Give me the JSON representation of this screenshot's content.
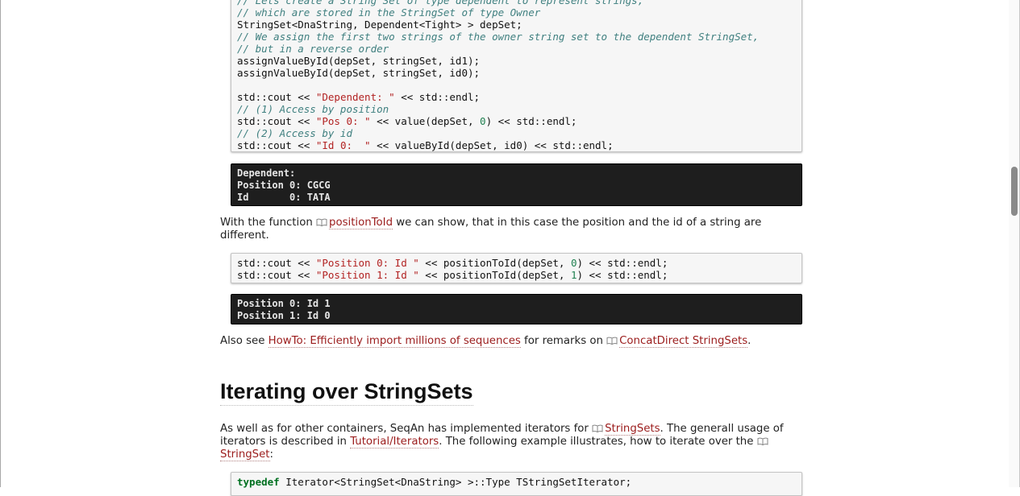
{
  "code_block_1": {
    "lines": [
      [
        {
          "c": "cm",
          "t": "// Lets create a String Set of type dependent to represent strings,"
        }
      ],
      [
        {
          "c": "cm",
          "t": "// which are stored in the StringSet of type Owner"
        }
      ],
      [
        {
          "c": "",
          "t": "StringSet<DnaString, Dependent<Tight> > depSet;"
        }
      ],
      [
        {
          "c": "cm",
          "t": "// We assign the first two strings of the owner string set to the dependent StringSet,"
        }
      ],
      [
        {
          "c": "cm",
          "t": "// but in a reverse order"
        }
      ],
      [
        {
          "c": "",
          "t": "assignValueById(depSet, stringSet, id1);"
        }
      ],
      [
        {
          "c": "",
          "t": "assignValueById(depSet, stringSet, id0);"
        }
      ],
      [
        {
          "c": "",
          "t": ""
        }
      ],
      [
        {
          "c": "",
          "t": "std::cout << "
        },
        {
          "c": "st",
          "t": "\"Dependent: \""
        },
        {
          "c": "",
          "t": " << std::endl;"
        }
      ],
      [
        {
          "c": "cm",
          "t": "// (1) Access by position"
        }
      ],
      [
        {
          "c": "",
          "t": "std::cout << "
        },
        {
          "c": "st",
          "t": "\"Pos 0: \""
        },
        {
          "c": "",
          "t": " << value(depSet, "
        },
        {
          "c": "num",
          "t": "0"
        },
        {
          "c": "",
          "t": ") << std::endl;"
        }
      ],
      [
        {
          "c": "cm",
          "t": "// (2) Access by id"
        }
      ],
      [
        {
          "c": "",
          "t": "std::cout << "
        },
        {
          "c": "st",
          "t": "\"Id 0:  \""
        },
        {
          "c": "",
          "t": " << valueById(depSet, id0) << std::endl;"
        }
      ]
    ]
  },
  "output_block_1": {
    "lines": [
      "Dependent:",
      "Position 0: CGCG",
      "Id       0: TATA"
    ]
  },
  "para_1": {
    "before": "With the function ",
    "link": "positionToId",
    "after": " we can show, that in this case the position and the id of a string are different."
  },
  "code_block_2": {
    "lines": [
      [
        {
          "c": "",
          "t": "std::cout << "
        },
        {
          "c": "st",
          "t": "\"Position 0: Id \""
        },
        {
          "c": "",
          "t": " << positionToId(depSet, "
        },
        {
          "c": "num",
          "t": "0"
        },
        {
          "c": "",
          "t": ") << std::endl;"
        }
      ],
      [
        {
          "c": "",
          "t": "std::cout << "
        },
        {
          "c": "st",
          "t": "\"Position 1: Id \""
        },
        {
          "c": "",
          "t": " << positionToId(depSet, "
        },
        {
          "c": "num",
          "t": "1"
        },
        {
          "c": "",
          "t": ") << std::endl;"
        }
      ]
    ]
  },
  "output_block_2": {
    "lines": [
      "Position 0: Id 1",
      "Position 1: Id 0"
    ]
  },
  "para_2": {
    "before": "Also see ",
    "link1": "HowTo: Efficiently import millions of sequences",
    "middle": " for remarks on ",
    "link2": "ConcatDirect StringSets",
    "after": "."
  },
  "section": {
    "title": "Iterating over StringSets"
  },
  "para_3": {
    "before": "As well as for other containers, SeqAn has implemented iterators for ",
    "link1": "StringSets",
    "middle1": ". The generall usage of iterators is described in ",
    "link2": "Tutorial/Iterators",
    "middle2": ". The following example illustrates, how to iterate over the ",
    "link3": "StringSet",
    "after": ":"
  },
  "code_block_3": {
    "lines": [
      [
        {
          "c": "kw",
          "t": "typedef"
        },
        {
          "c": "",
          "t": " Iterator<StringSet<DnaString> >::Type TStringSetIterator;"
        }
      ]
    ]
  },
  "colors": {
    "link": "#9b1c1c",
    "comment": "#408080",
    "string": "#b22222",
    "output_bg": "#1e1e1e"
  }
}
